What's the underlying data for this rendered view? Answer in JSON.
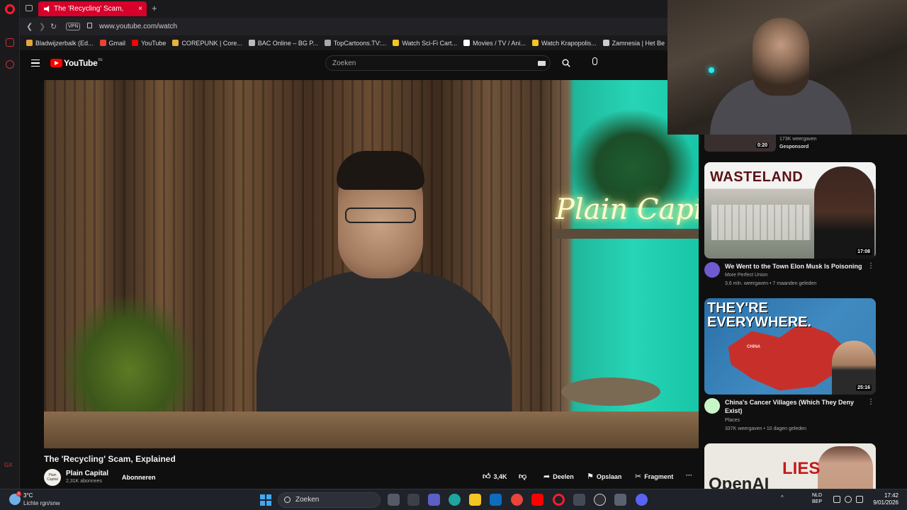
{
  "browser": {
    "tab_title": "The 'Recycling' Scam,",
    "tab_close": "×",
    "tab_add": "+",
    "url": "www.youtube.com/watch",
    "vpn_label": "VPN",
    "bookmarks": [
      {
        "label": "Bladwijzerbalk (Ed...",
        "color": "#e8a33b"
      },
      {
        "label": "Gmail",
        "color": "#ea4335"
      },
      {
        "label": "YouTube",
        "color": "#ff0000"
      },
      {
        "label": "COREPUNK | Core...",
        "color": "#e8b23b"
      },
      {
        "label": "BAC Online – BG P...",
        "color": "#bbbbbb"
      },
      {
        "label": "TopCartoons.TV:...",
        "color": "#aaaaaa"
      },
      {
        "label": "Watch Sci-Fi Cart...",
        "color": "#f3c623"
      },
      {
        "label": "Movies / TV / Ani...",
        "color": "#ffffff"
      },
      {
        "label": "Watch Krapopolis...",
        "color": "#f3c623"
      },
      {
        "label": "Zamnesia | Het Be",
        "color": "#cccccc"
      }
    ]
  },
  "youtube": {
    "logo_word": "YouTube",
    "logo_region": "BE",
    "search_placeholder": "Zoeken"
  },
  "video": {
    "title": "The 'Recycling' Scam, Explained",
    "neon_sign": "Plain Capital",
    "channel": {
      "name": "Plain Capital",
      "subs": "2,31K abonnees",
      "avatar_text": "Plain Capital"
    },
    "subscribe_label": "Abonneren",
    "actions": {
      "likes": "3,4K",
      "share": "Deelen",
      "save": "Opslaan",
      "clip": "Fragment",
      "more": "···"
    }
  },
  "sidebar": {
    "top_item": {
      "duration": "0:20",
      "views": "173K weergaven",
      "sponsored": "Gesponsord"
    },
    "items": [
      {
        "thumb_text": "WASTELAND",
        "duration": "17:08",
        "title": "We Went to the Town Elon Musk Is Poisoning",
        "channel": "More Perfect Union",
        "meta": "3,6 mln. weergaven • 7 maanden geleden",
        "avatar_color": "#6f5bd0"
      },
      {
        "thumb_text": "THEY'RE EVERYWHERE.",
        "thumb_sub": "CHINA",
        "duration": "25:16",
        "title": "China's Cancer Villages (Which They Deny Exist)",
        "channel": "Places",
        "meta": "337K weergaven • 10 dagen geleden",
        "avatar_color": "#c8f5c8"
      },
      {
        "thumb_text": "LIES",
        "thumb_sub": "OpenAI"
      }
    ],
    "more_icon": "⋮"
  },
  "taskbar": {
    "temp": "3°C",
    "condition": "Lichte rgn/snw",
    "weather_badge": "2",
    "search_label": "Zoeken",
    "lang_top": "NLD",
    "lang_bottom": "BEP",
    "time": "17:42",
    "date": "9/01/2026"
  },
  "opera_rail": {
    "label_bottom": "GX"
  }
}
